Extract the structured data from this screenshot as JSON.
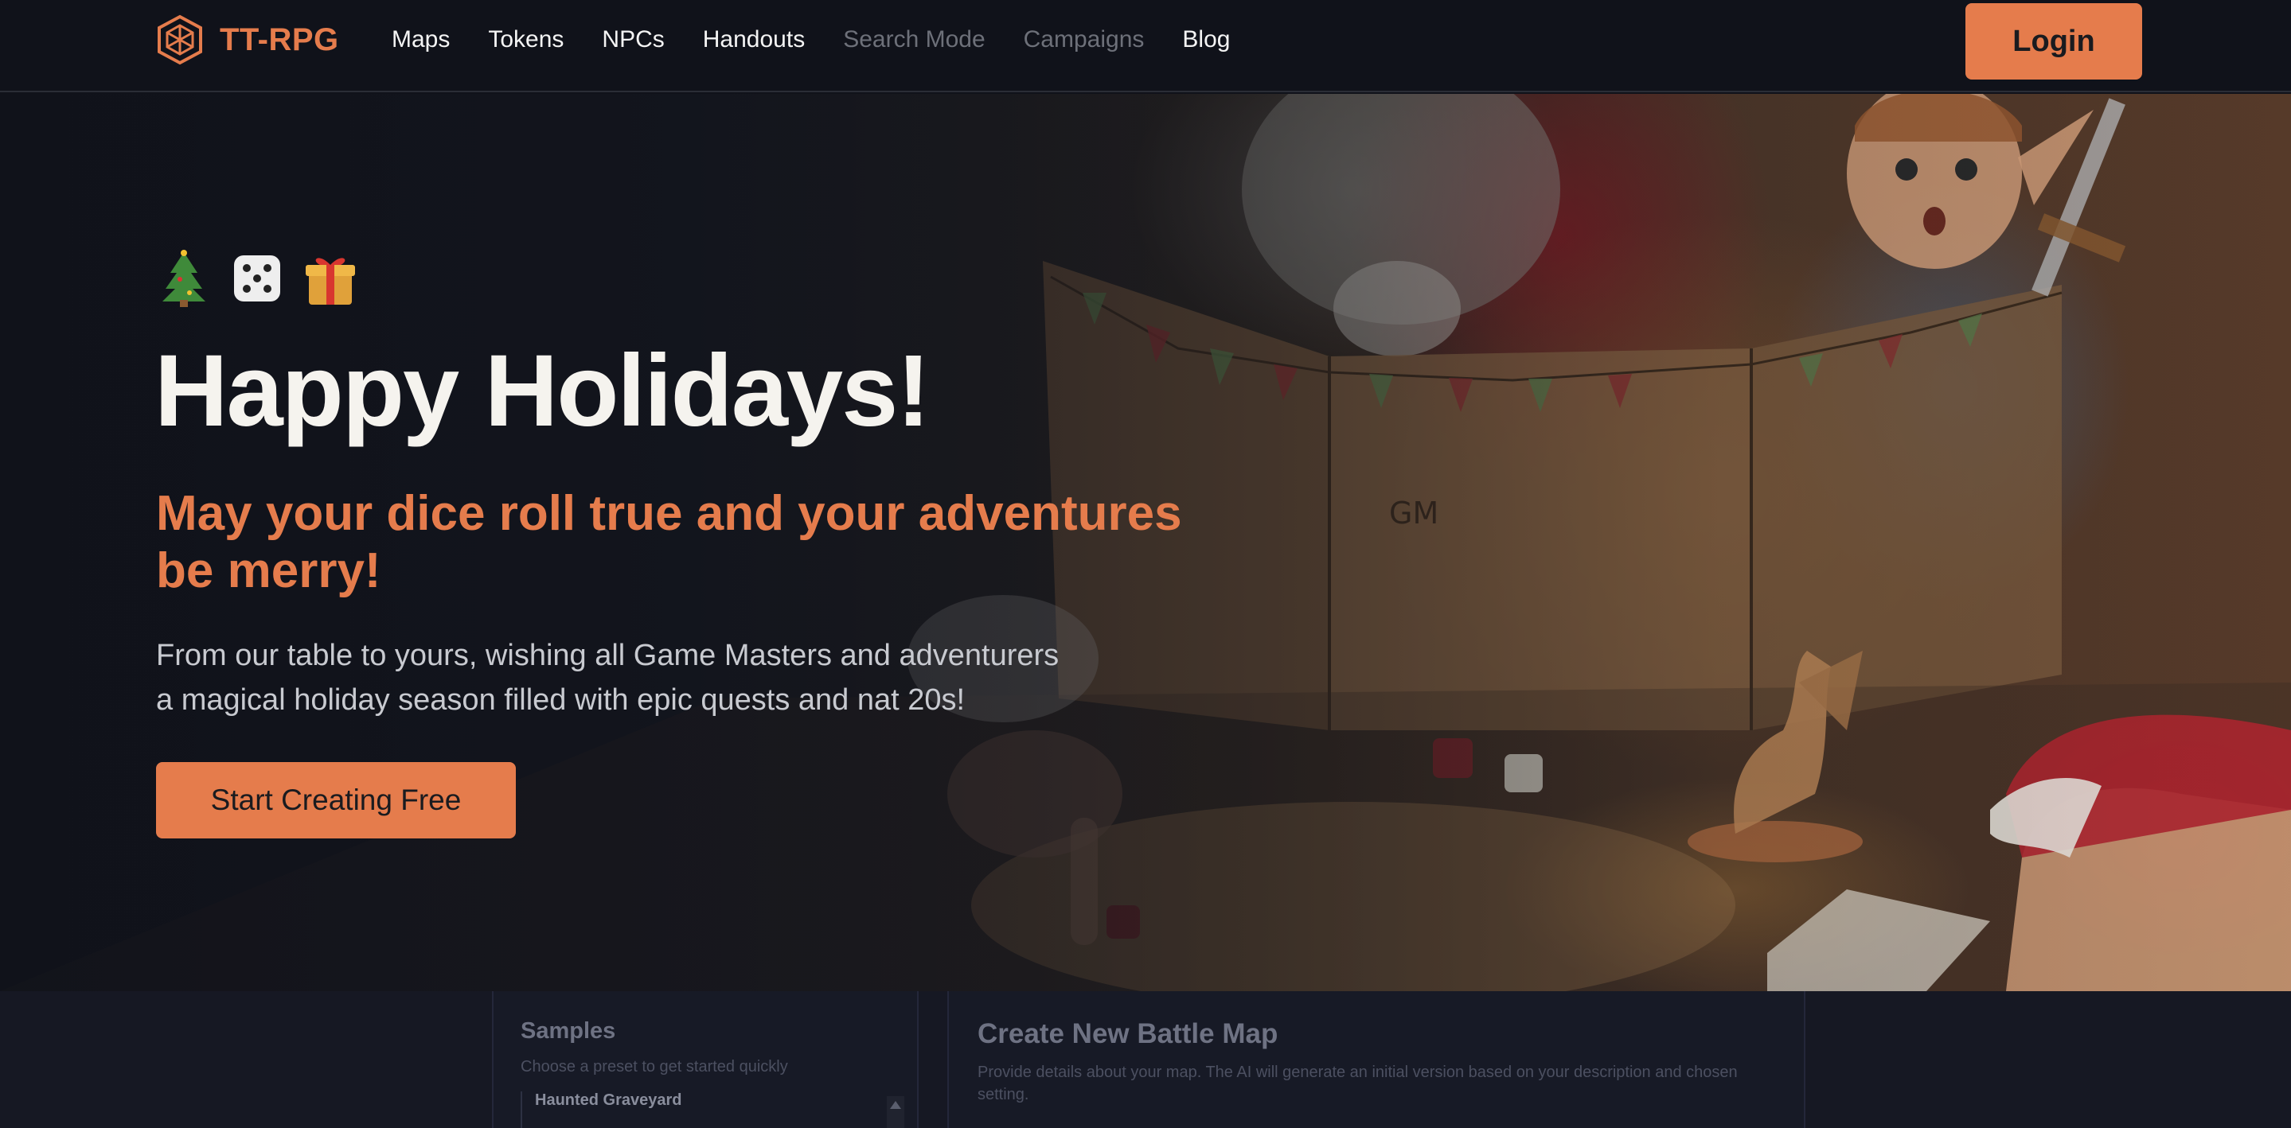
{
  "brand": {
    "name": "TT-RPG",
    "accent": "#e57c4c"
  },
  "nav": {
    "links": [
      {
        "label": "Maps",
        "state": "active"
      },
      {
        "label": "Tokens",
        "state": "active"
      },
      {
        "label": "NPCs",
        "state": "active"
      },
      {
        "label": "Handouts",
        "state": "active"
      },
      {
        "label": "Search Mode",
        "state": "dimmed"
      },
      {
        "label": "Campaigns",
        "state": "dimmed"
      },
      {
        "label": "Blog",
        "state": "active"
      }
    ],
    "login_label": "Login"
  },
  "hero": {
    "emojis": [
      "christmas-tree",
      "dice",
      "gift"
    ],
    "title": "Happy Holidays!",
    "subtitle": "May your dice roll true and your adventures be merry!",
    "description_line1": "From our table to yours, wishing all Game Masters and adventurers",
    "description_line2": "a magical holiday season filled with epic quests and nat 20s!",
    "cta_label": "Start Creating Free",
    "art_labels": {
      "screen_text": "GM"
    }
  },
  "preview": {
    "samples": {
      "title": "Samples",
      "subtitle": "Choose a preset to get started quickly",
      "first_item": "Haunted Graveyard"
    },
    "create": {
      "title": "Create New Battle Map",
      "description": "Provide details about your map. The AI will generate an initial version based on your description and chosen setting."
    }
  }
}
